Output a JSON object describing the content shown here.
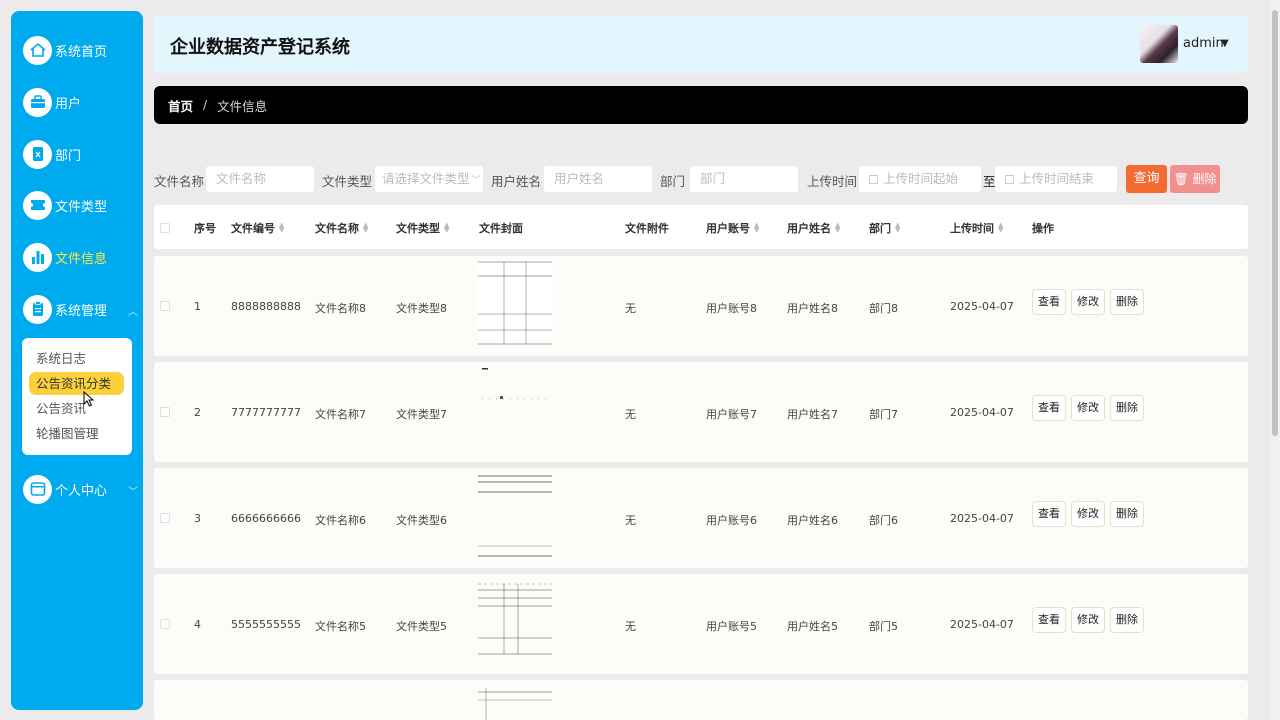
{
  "sidebar": {
    "items": [
      {
        "label": "系统首页",
        "icon": "home-icon"
      },
      {
        "label": "用户",
        "icon": "briefcase-icon"
      },
      {
        "label": "部门",
        "icon": "document-icon"
      },
      {
        "label": "文件类型",
        "icon": "ticket-icon"
      },
      {
        "label": "文件信息",
        "icon": "bar-chart-icon"
      },
      {
        "label": "系统管理",
        "icon": "clipboard-icon"
      },
      {
        "label": "个人中心",
        "icon": "window-icon"
      }
    ],
    "submenu": [
      "系统日志",
      "公告资讯分类",
      "公告资讯",
      "轮播图管理"
    ]
  },
  "header": {
    "title": "企业数据资产登记系统",
    "user": "admin"
  },
  "breadcrumb": {
    "home": "首页",
    "separator": "/",
    "current": "文件信息"
  },
  "search": {
    "file_name_label": "文件名称",
    "file_name_placeholder": "文件名称",
    "file_type_label": "文件类型",
    "file_type_placeholder": "请选择文件类型",
    "user_name_label": "用户姓名",
    "user_name_placeholder": "用户姓名",
    "dept_label": "部门",
    "dept_placeholder": "部门",
    "upload_time_label": "上传时间",
    "start_placeholder": "上传时间起始",
    "to_label": "至",
    "end_placeholder": "上传时间结束",
    "query_button": "查询",
    "delete_button": "删除"
  },
  "table": {
    "headers": [
      "序号",
      "文件编号",
      "文件名称",
      "文件类型",
      "文件封面",
      "文件附件",
      "用户账号",
      "用户姓名",
      "部门",
      "上传时间",
      "操作"
    ],
    "rows": [
      {
        "index": "1",
        "code": "8888888888",
        "name": "文件名称8",
        "type": "文件类型8",
        "attachment": "无",
        "account": "用户账号8",
        "user": "用户姓名8",
        "dept": "部门8",
        "date": "2025-04-07"
      },
      {
        "index": "2",
        "code": "7777777777",
        "name": "文件名称7",
        "type": "文件类型7",
        "attachment": "无",
        "account": "用户账号7",
        "user": "用户姓名7",
        "dept": "部门7",
        "date": "2025-04-07"
      },
      {
        "index": "3",
        "code": "6666666666",
        "name": "文件名称6",
        "type": "文件类型6",
        "attachment": "无",
        "account": "用户账号6",
        "user": "用户姓名6",
        "dept": "部门6",
        "date": "2025-04-07"
      },
      {
        "index": "4",
        "code": "5555555555",
        "name": "文件名称5",
        "type": "文件类型5",
        "attachment": "无",
        "account": "用户账号5",
        "user": "用户姓名5",
        "dept": "部门5",
        "date": "2025-04-07"
      }
    ],
    "actions": {
      "view": "查看",
      "edit": "修改",
      "delete": "删除"
    }
  },
  "colors": {
    "sidebar": "#00aaee",
    "active_nav": "#ffe94a",
    "active_sub": "#fbd03a",
    "header_bg": "#e3f6fd",
    "query_btn": "#f46a30",
    "delete_btn": "#f28f8f"
  }
}
